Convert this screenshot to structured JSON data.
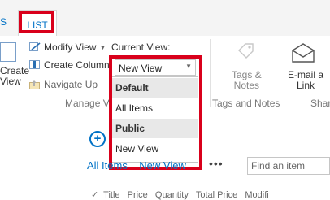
{
  "tabs": {
    "partial": "S",
    "list": "LIST"
  },
  "ribbon": {
    "create_view": "Create\nView",
    "modify_view": "Modify View",
    "create_column": "Create Column",
    "navigate_up": "Navigate Up",
    "current_view_label": "Current View:",
    "current_view_value": "New View",
    "manage_views_group": "Manage Vi",
    "tags_notes": "Tags &\nNotes",
    "tags_group": "Tags and Notes",
    "email_link": "E-mail a\nLink",
    "share_group": "Share"
  },
  "view_menu": {
    "sections": [
      {
        "header": "Default",
        "items": [
          "All Items"
        ]
      },
      {
        "header": "Public",
        "items": [
          "New View"
        ]
      }
    ]
  },
  "page": {
    "add_icon": "plus-circle-icon",
    "views_tabs": "All Items    New View",
    "ellipsis": "•••",
    "search_placeholder": "Find an item",
    "column_headers": "✓  Title   Price   Quantity   Total Price   Modifi"
  },
  "colors": {
    "highlight": "#d9001b",
    "link": "#0072c6"
  }
}
